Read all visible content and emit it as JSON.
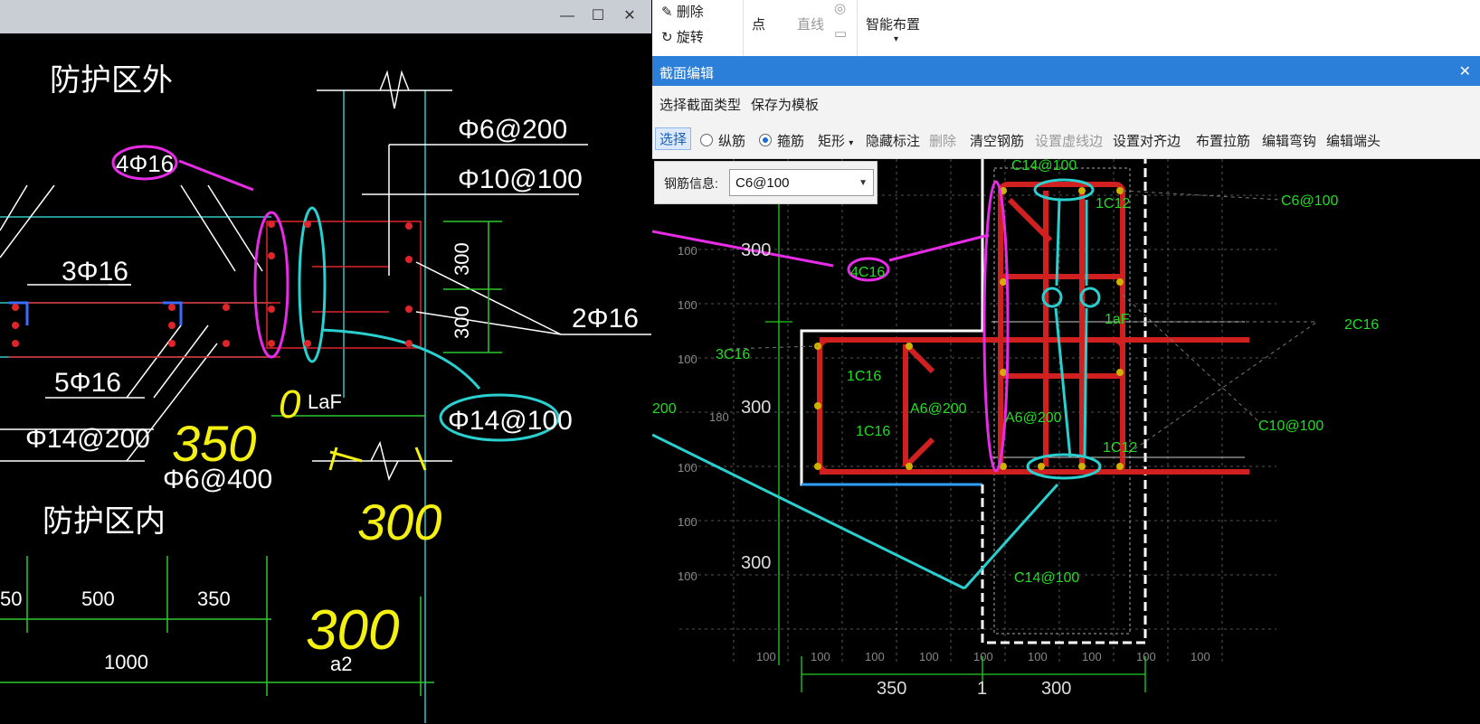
{
  "left_window": {
    "controls": {
      "minimize": "—",
      "maximize": "☐",
      "close": "✕"
    },
    "labels": {
      "outside": "防护区外",
      "inside": "防护区内",
      "phi6_200": "Φ6@200",
      "phi10_100": "Φ10@100",
      "four_phi16": "4Φ16",
      "three_phi16": "3Φ16",
      "two_phi16": "2Φ16",
      "five_phi16": "5Φ16",
      "phi14_200": "Φ14@200",
      "phi14_100": "Φ14@100",
      "phi6_400": "Φ6@400",
      "laf": "LaF",
      "dim300a": "300",
      "dim300b": "300",
      "dim50": "50",
      "dim500": "500",
      "dim350": "350",
      "dim1000": "1000",
      "a2": "a2",
      "hw350": "350",
      "hw0": "0",
      "hw300a": "300",
      "hw300b": "300"
    }
  },
  "right_window": {
    "ribbon": {
      "delete": "删除",
      "rotate": "旋转",
      "point": "点",
      "line": "直线",
      "smart_layout": "智能布置"
    },
    "dialog_title": "截面编辑",
    "dialog_close": "✕",
    "toolbar1": [
      "选择截面类型",
      "保存为模板"
    ],
    "toolbar2": {
      "select": "选择",
      "longitudinal": "纵筋",
      "stirrup": "箍筋",
      "rect": "矩形",
      "hide_label": "隐藏标注",
      "delete": "删除",
      "clear": "清空钢筋",
      "set_dashed": "设置虚线边",
      "set_align": "设置对齐边",
      "place_tie": "布置拉筋",
      "edit_hook": "编辑弯钩",
      "edit_end": "编辑端头"
    },
    "rebar_info": {
      "label": "钢筋信息:",
      "value": "C6@100"
    },
    "canvas": {
      "c14_top": "C14@100",
      "c14_bottom": "C14@100",
      "one_c12_top": "1C12",
      "one_c12_bottom": "1C12",
      "c6": "C6@100",
      "four_c16": "4C16",
      "three_c16": "3C16",
      "one_c16_a": "1C16",
      "one_c16_b": "1C16",
      "a6_200_a": "A6@200",
      "a6_200_b": "A6@200",
      "two_c16": "2C16",
      "c10": "C10@100",
      "laf": "1aF",
      "d300a": "300",
      "d300b": "300",
      "d300c": "300",
      "d200": "200",
      "d350": "350",
      "d1": "1",
      "d300bottom": "300",
      "grid100": "100",
      "grid180": "180"
    }
  }
}
